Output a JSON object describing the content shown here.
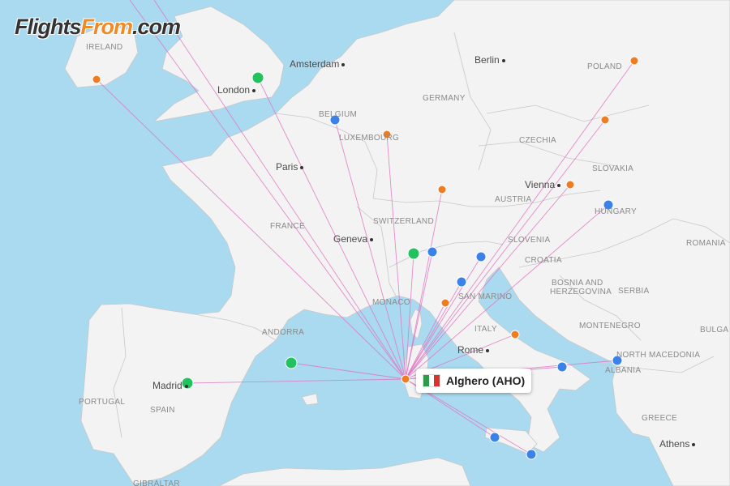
{
  "logo": {
    "part1": "Flights",
    "part2": "From",
    "part3": ".com"
  },
  "origin": {
    "label": "Alghero (AHO)",
    "flag_icon": "italy-flag-icon"
  },
  "legend_colors": {
    "origin": "#f07c22",
    "orange": "#f07c22",
    "blue": "#3b82e8",
    "green": "#22c35e",
    "route": "#e070c0",
    "sea": "#aadaf0",
    "land": "#f3f3f3",
    "border": "#c8c8c8"
  },
  "countries": [
    "IRELAND",
    "GERMANY",
    "POLAND",
    "BELGIUM",
    "LUXEMBOURG",
    "CZECHIA",
    "SLOVAKIA",
    "FRANCE",
    "SWITZERLAND",
    "AUSTRIA",
    "HUNGARY",
    "ROMANIA",
    "SLOVENIA",
    "CROATIA",
    "BOSNIA AND",
    "HERZEGOVINA",
    "SERBIA",
    "MONACO",
    "SAN MARINO",
    "ANDORRA",
    "ITALY",
    "MONTENEGRO",
    "BULGA",
    "NORTH MACEDONIA",
    "ALBANIA",
    "PORTUGAL",
    "SPAIN",
    "GREECE",
    "GIBRALTAR"
  ],
  "cities": [
    "Amsterdam",
    "Berlin",
    "London",
    "Paris",
    "Vienna",
    "Geneva",
    "Rome",
    "Madrid",
    "Athens"
  ],
  "airports": [
    {
      "color": "orange"
    },
    {
      "color": "green"
    },
    {
      "color": "blue"
    },
    {
      "color": "orange"
    },
    {
      "color": "orange"
    },
    {
      "color": "orange"
    },
    {
      "color": "orange"
    },
    {
      "color": "orange"
    },
    {
      "color": "blue"
    },
    {
      "color": "green"
    },
    {
      "color": "blue"
    },
    {
      "color": "blue"
    },
    {
      "color": "blue"
    },
    {
      "color": "orange"
    },
    {
      "color": "orange"
    },
    {
      "color": "blue"
    },
    {
      "color": "blue"
    },
    {
      "color": "green"
    },
    {
      "color": "green"
    },
    {
      "color": "blue"
    },
    {
      "color": "blue"
    }
  ]
}
